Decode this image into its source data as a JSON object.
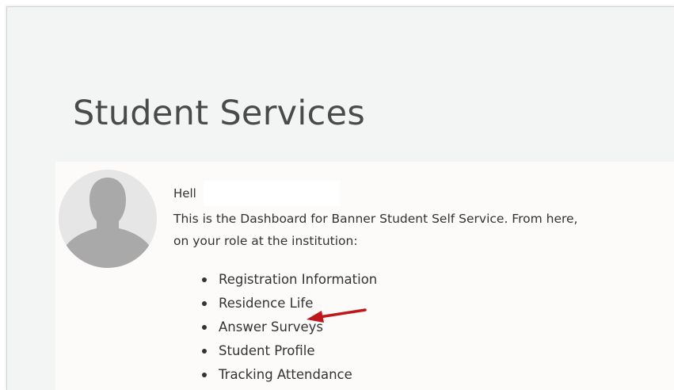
{
  "page": {
    "title": "Student Services"
  },
  "dashboard": {
    "greeting": "Hell",
    "intro_line1": "This is the Dashboard for Banner Student Self Service. From here,",
    "intro_line2": "on your role at the institution:",
    "menu_items": [
      "Registration Information",
      "Residence Life",
      "Answer Surveys",
      "Student Profile",
      "Tracking Attendance"
    ]
  },
  "icons": {
    "avatar": "user-silhouette-icon",
    "annotation": "red-arrow-icon"
  },
  "colors": {
    "frame_background": "#f3f5f5",
    "panel_background": "#fdfafa",
    "text": "#333333",
    "title": "#4a4a4a",
    "avatar_circle": "#e6e6e6",
    "avatar_figure": "#a9a9a9",
    "annotation_arrow": "#c0171c"
  }
}
